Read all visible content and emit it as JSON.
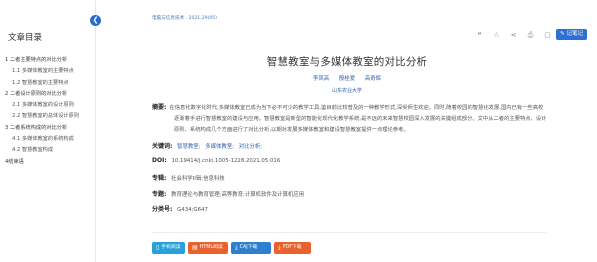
{
  "sidebar": {
    "collapse_icon": "chevron-left-icon",
    "title": "文章目录",
    "toc": [
      {
        "label": "1 二者主要特点的对比分析",
        "level": 1
      },
      {
        "label": "1.1 多媒体教室的主要特点",
        "level": 2
      },
      {
        "label": "1.2 智慧教室的主要特点",
        "level": 2
      },
      {
        "label": "2 二者设计原则的对比分析",
        "level": 1
      },
      {
        "label": "2.1 多媒体教室的设计原则",
        "level": 2
      },
      {
        "label": "2.2 智慧教室的总体设计原则",
        "level": 2
      },
      {
        "label": "3 二者系统构成的对比分析",
        "level": 1
      },
      {
        "label": "4.1 多媒体教室的系统构成",
        "level": 2
      },
      {
        "label": "4.2 智慧教室构成",
        "level": 2
      },
      {
        "label": "4结束语",
        "level": 1
      }
    ]
  },
  "header": {
    "source": "电脑与信息技术 . 2021,29(05)",
    "icons": [
      "quote-icon",
      "star-icon",
      "share-icon",
      "print-icon",
      "chat-icon"
    ],
    "record_label": "记笔记"
  },
  "article": {
    "title": "智慧教室与多媒体教室的对比分析",
    "authors": [
      "李凤高",
      "殷桂爱",
      "高奇辉"
    ],
    "affiliation": "山东农业大学",
    "abstract_label": "摘要:",
    "abstract": "在信息化数字化时代,多媒体教室已成为当下必不可少的教学工具,鉴目前比较普及的一种教学形式,深受师生欢迎。同时,随着校园的智慧化发展,国内已有一些高校逐渐着手进行智慧教室的建设与应用。智慧教室是新型的智能化现代化教学系统,是不远的未来智慧校园深入发展的关键组成部分。文中从二者的主要特点、设计原则、系统构成几个方面进行了对比分析,以期对发展多媒体教室和建设智慧教室提供一点理论参考。",
    "keywords_label": "关键词:",
    "keywords": [
      "智慧教室;",
      "多媒体教室;",
      "对比分析;"
    ],
    "doi_label": "DOI:",
    "doi": "10.19414/j.cnki.1005-1228.2021.05.016",
    "column_label": "专辑:",
    "column": "社会科学II辑;信息科技",
    "subject_label": "专题:",
    "subject": "教育理论与教育管理;高等教育;计算机软件及计算机应用",
    "class_label": "分类号:",
    "class_no": "G434;G647"
  },
  "downloads": {
    "mobile": {
      "label": "手机阅读",
      "icon": "phone-icon"
    },
    "html": {
      "label": "HTML阅读",
      "icon": "document-icon"
    },
    "caj": {
      "label": "CAJ下载",
      "icon": "download-icon"
    },
    "pdf": {
      "label": "PDF下载",
      "icon": "pdf-icon"
    }
  }
}
